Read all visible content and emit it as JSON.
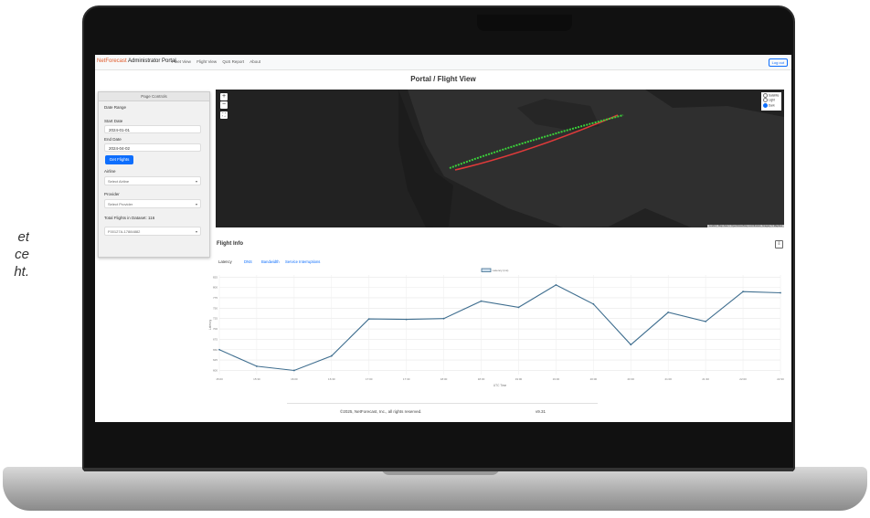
{
  "caption": {
    "lines": [
      "et",
      "ce",
      "ht."
    ]
  },
  "navbar": {
    "brand_accent": "NetForecast",
    "brand_rest": " Administrator Portal",
    "links": [
      "Fleet View",
      "Flight View",
      "QoS Report",
      "About"
    ],
    "logout_label": "Log out"
  },
  "page": {
    "title": "Portal / Flight View"
  },
  "controls": {
    "header": "Page Controls",
    "date_range_label": "Date Range",
    "start_label": "Start Date",
    "start_value": "2024-01-01",
    "end_label": "End Date",
    "end_value": "2024-04-02",
    "get_flights_label": "Get Flights",
    "airline_label": "Airline",
    "airline_value": "Select Airline",
    "provider_label": "Provider",
    "provider_value": "Select Provider",
    "total_label": "Total Flights in Dataset: 116",
    "flight_value": "F00127A-17884882"
  },
  "map": {
    "zoom_in": "+",
    "zoom_out": "−",
    "layers": [
      "Satellite",
      "Light",
      "Dark"
    ],
    "selected_layer": "Dark",
    "attribution": "Leaflet | Map data © OpenStreetMap contributors, Imagery © Mapbox",
    "route_colors": {
      "planned": "#e03a3a",
      "actual": "#3ad13a"
    }
  },
  "flight_info": {
    "title": "Flight Info",
    "tabs": [
      "Latency",
      "DNS",
      "Bandwidth",
      "Service Interruptions"
    ],
    "active_tab": "Latency"
  },
  "chart_data": {
    "type": "line",
    "legend": [
      "Latency (ms)"
    ],
    "x": [
      "15:00",
      "15:30",
      "16:00",
      "16:30",
      "17:00",
      "17:30",
      "18:00",
      "18:30",
      "19:00",
      "19:30",
      "20:00",
      "20:30",
      "21:00",
      "21:30",
      "22:00",
      "22:30"
    ],
    "series": [
      {
        "name": "Latency (ms)",
        "values": [
          650,
          610,
          600,
          635,
          724,
          723,
          725,
          767,
          752,
          806,
          760,
          662,
          740,
          718,
          790,
          787
        ],
        "color": "#3f6e8f"
      }
    ],
    "ylim": [
      590,
      830
    ],
    "yticks": [
      600,
      625,
      650,
      675,
      700,
      725,
      750,
      775,
      800,
      825
    ],
    "xlabel": "UTC Time",
    "ylabel": "Latency"
  },
  "footer": {
    "copyright": "©2025, NetForecast, Inc., all rights reserved.",
    "version": "v9.31"
  }
}
